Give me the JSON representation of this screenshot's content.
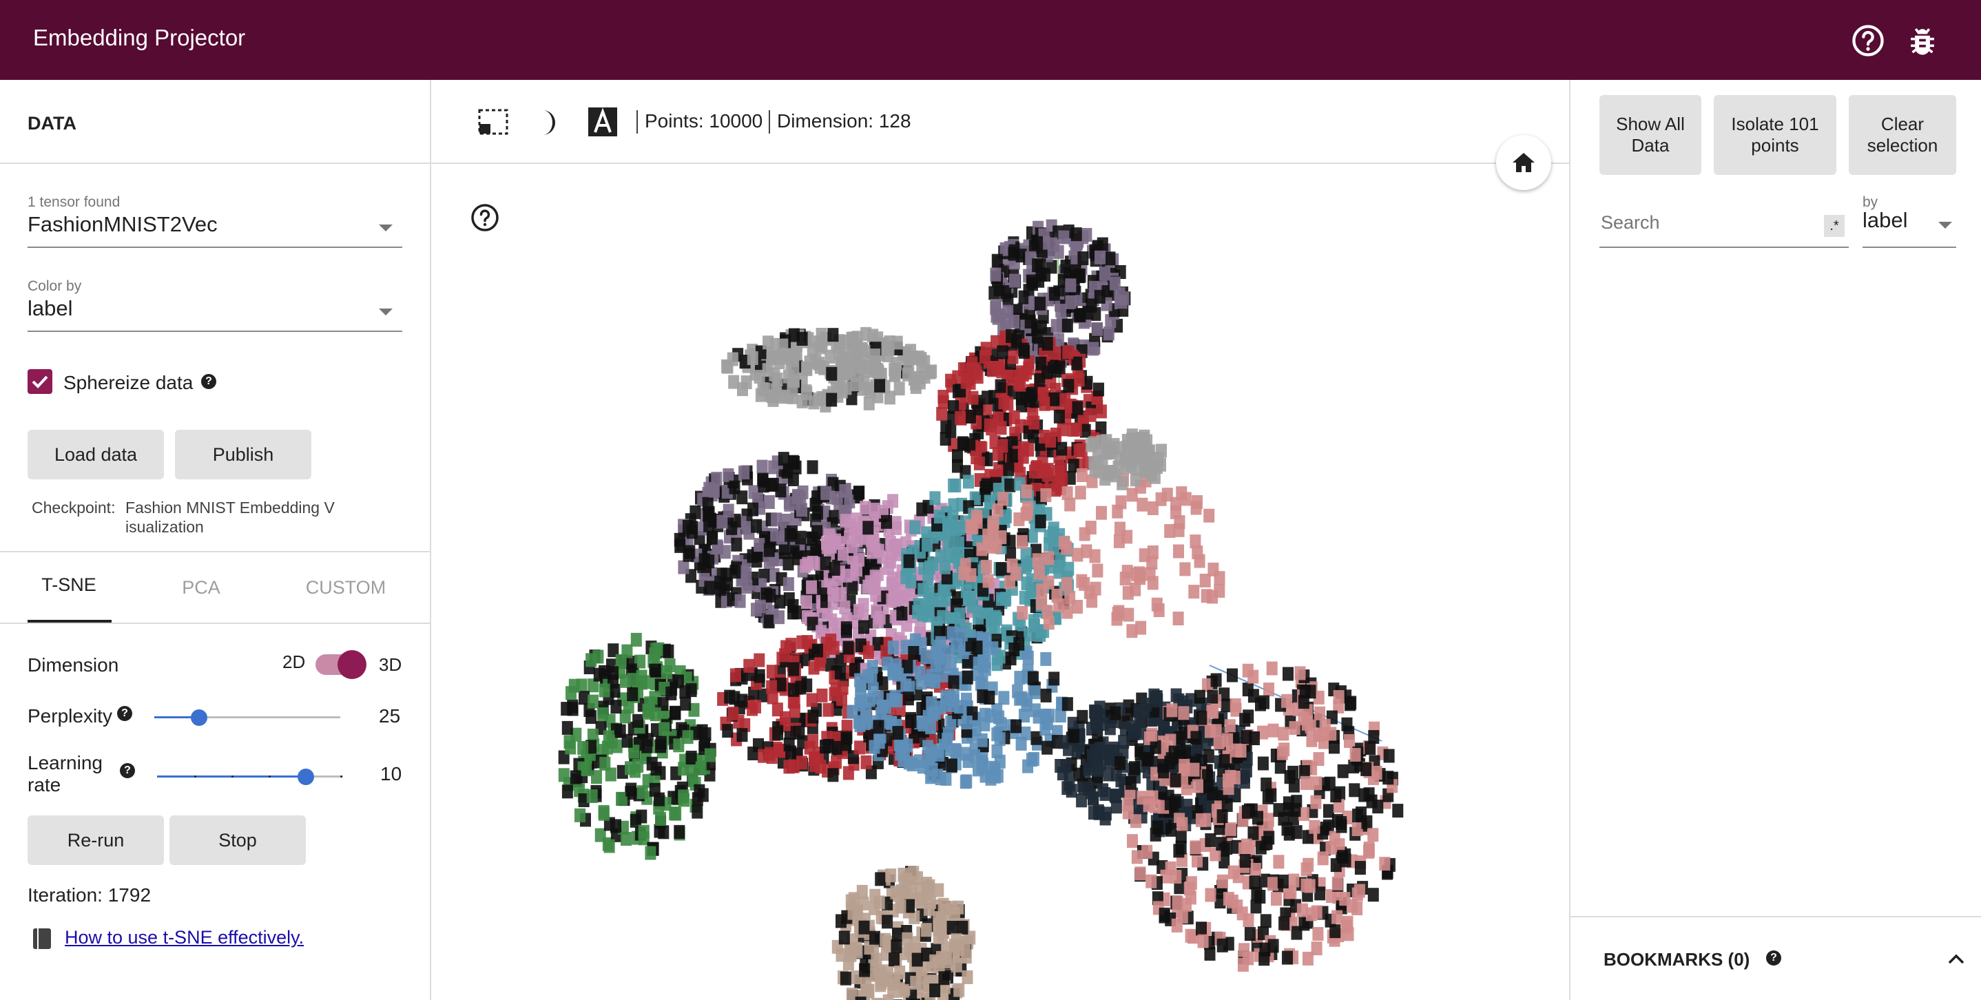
{
  "app": {
    "title": "Embedding Projector"
  },
  "header": {
    "help_icon": "help-circle-icon",
    "bug_icon": "bug-icon"
  },
  "data_panel": {
    "section_title": "DATA",
    "tensor_label": "1 tensor found",
    "tensor_value": "FashionMNIST2Vec",
    "color_by_label": "Color by",
    "color_by_value": "label",
    "sphereize_label": "Sphereize data",
    "sphereize_checked": true,
    "load_button": "Load data",
    "publish_button": "Publish",
    "checkpoint_label": "Checkpoint:",
    "checkpoint_value_line1": "Fashion MNIST Embedding V",
    "checkpoint_value_line2": "isualization"
  },
  "tabs": {
    "tsne": "T-SNE",
    "pca": "PCA",
    "custom": "CUSTOM",
    "active": "T-SNE"
  },
  "tsne": {
    "dimension_label": "Dimension",
    "dim_2d": "2D",
    "dim_3d": "3D",
    "dimension_selected": "3D",
    "perplexity_label": "Perplexity",
    "perplexity_value": "25",
    "perplexity_fraction": 0.24,
    "learning_rate_label_line1": "Learning",
    "learning_rate_label_line2": "rate",
    "learning_rate_value": "10",
    "learning_rate_fraction": 0.8,
    "rerun_button": "Re-run",
    "stop_button": "Stop",
    "iteration_text": "Iteration: 1792",
    "help_link": "How to use t-SNE effectively."
  },
  "toolbar": {
    "points_text": "Points: 10000",
    "dimension_text": "Dimension: 128",
    "select_icon": "selection-rect-icon",
    "night_icon": "night-mode-icon",
    "labels_icon": "label-toggle-icon",
    "home_icon": "home-icon"
  },
  "inspector": {
    "show_all": "Show All Data",
    "isolate": "Isolate 101 points",
    "clear": "Clear selection",
    "search_placeholder": "Search",
    "regex_label": ".*",
    "by_label": "by",
    "by_value": "label",
    "bookmarks": "BOOKMARKS (0)"
  },
  "colors": {
    "header": "#560b33",
    "accent": "#8e1b53",
    "slider": "#3b6fd0",
    "clusters": [
      "#7a6a86",
      "#9e9e9e",
      "#b22b33",
      "#c58fb8",
      "#3d8a44",
      "#5e8fb8",
      "#d08a8a",
      "#1e2a36",
      "#b8a090",
      "#4e9aa6"
    ]
  }
}
